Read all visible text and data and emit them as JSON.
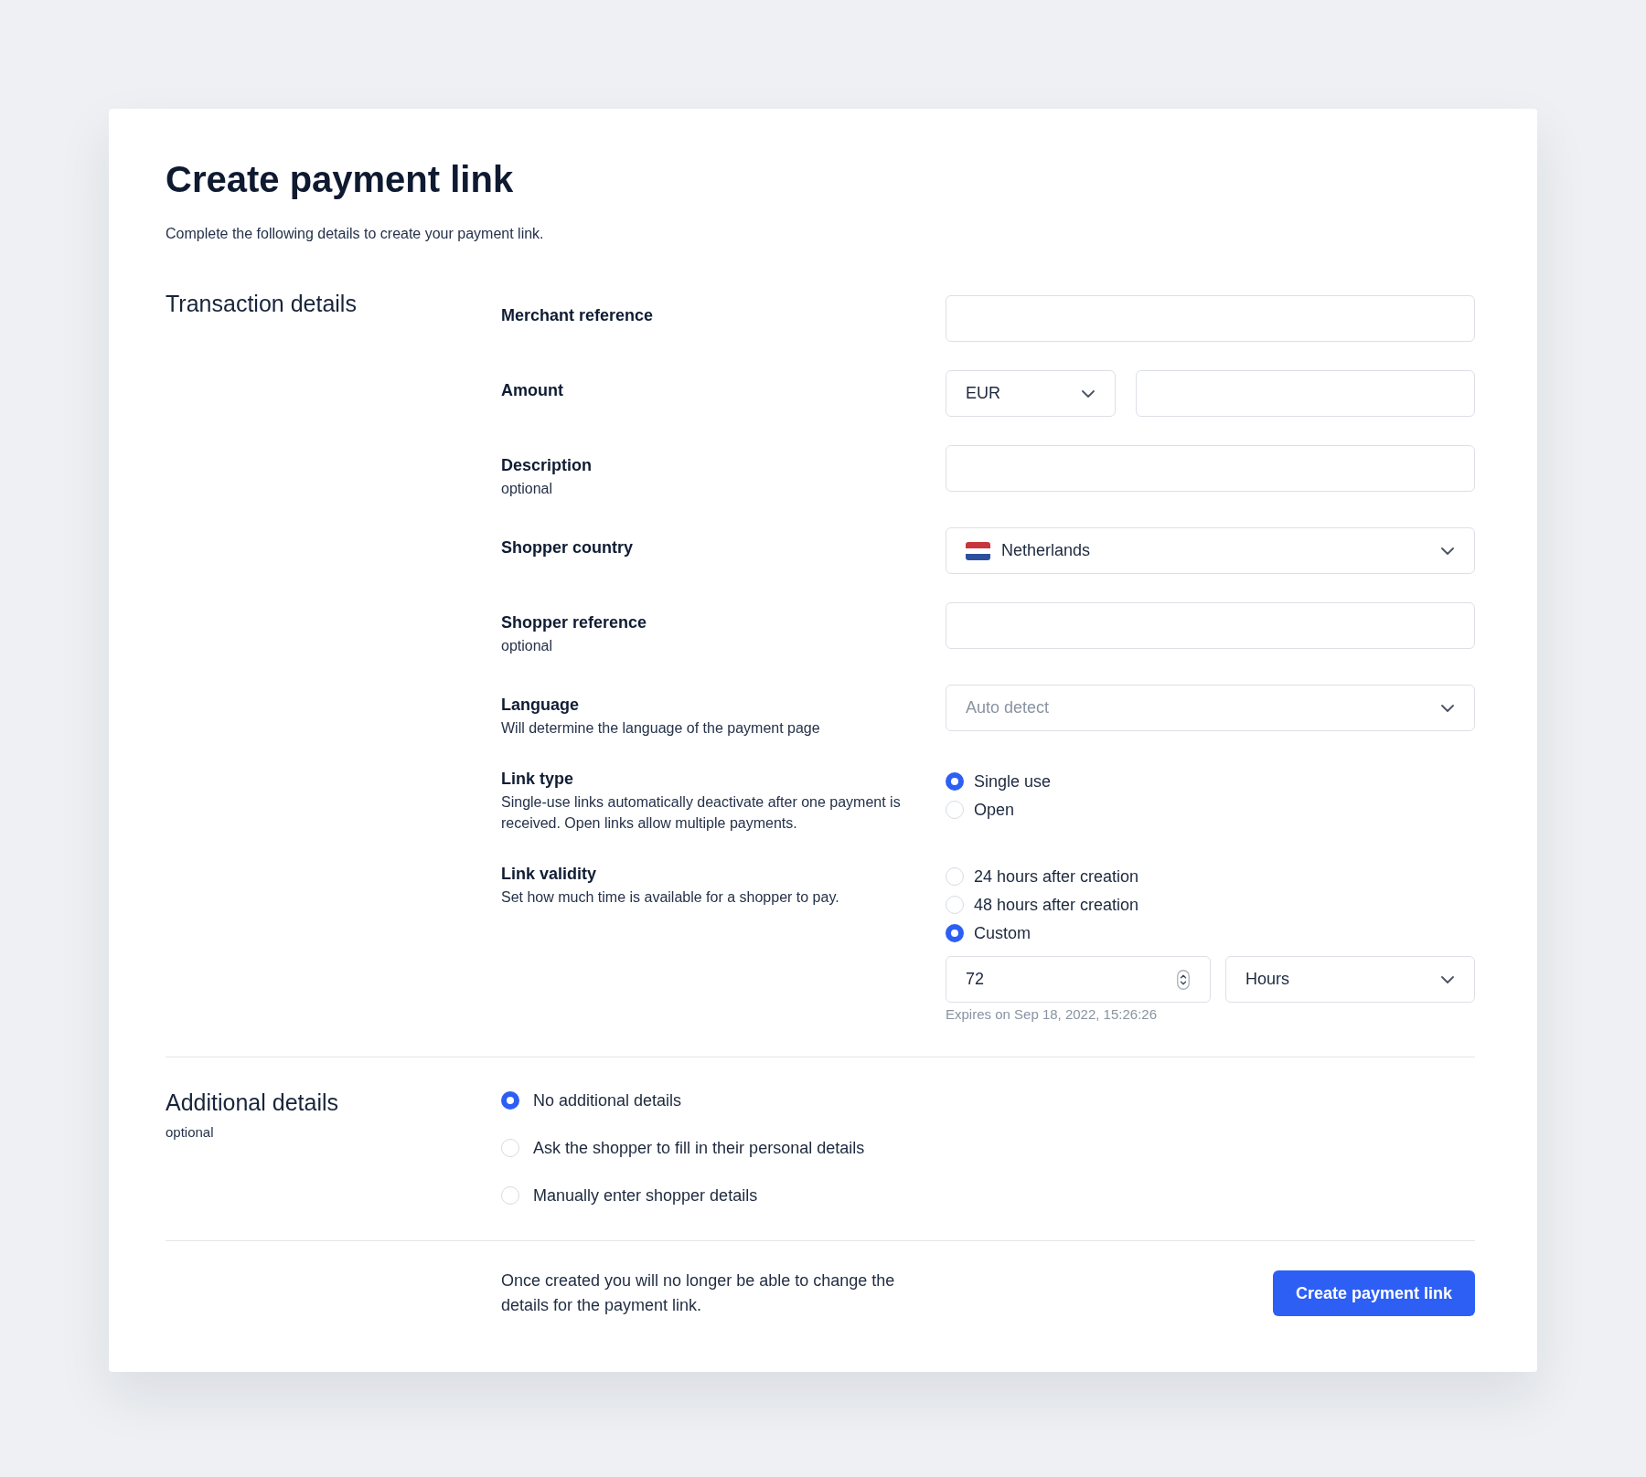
{
  "page": {
    "title": "Create payment link",
    "subtitle": "Complete the following details to create your payment link."
  },
  "transaction": {
    "title": "Transaction details",
    "fields": [
      {
        "kind": "text",
        "label": "Merchant reference"
      },
      {
        "kind": "amount",
        "label": "Amount",
        "currency": "EUR"
      },
      {
        "kind": "text",
        "label": "Description",
        "hint": "optional"
      },
      {
        "kind": "country",
        "label": "Shopper country",
        "value": "Netherlands"
      },
      {
        "kind": "text",
        "label": "Shopper reference",
        "hint": "optional"
      },
      {
        "kind": "select",
        "label": "Language",
        "hint": "Will determine the language of the payment page",
        "placeholder": "Auto detect"
      },
      {
        "kind": "radio",
        "label": "Link type",
        "hint": "Single-use links automatically deactivate after one payment is received. Open links allow multiple payments.",
        "options": [
          {
            "label": "Single use",
            "selected": true
          },
          {
            "label": "Open",
            "selected": false
          }
        ]
      },
      {
        "kind": "radio",
        "label": "Link validity",
        "hint": "Set how much time is available for a shopper to pay.",
        "options": [
          {
            "label": "24 hours after creation",
            "selected": false
          },
          {
            "label": "48 hours after creation",
            "selected": false
          },
          {
            "label": "Custom",
            "selected": true
          }
        ],
        "custom": {
          "value": "72",
          "unit": "Hours",
          "note": "Expires on Sep 18, 2022, 15:26:26"
        }
      }
    ]
  },
  "additional": {
    "title": "Additional details",
    "hint": "optional",
    "options": [
      {
        "label": "No additional details",
        "selected": true
      },
      {
        "label": "Ask the shopper to fill in their personal details",
        "selected": false
      },
      {
        "label": "Manually enter shopper details",
        "selected": false
      }
    ]
  },
  "footer": {
    "note": "Once created you will no longer be able to change the details for the payment link.",
    "button": "Create payment link"
  }
}
